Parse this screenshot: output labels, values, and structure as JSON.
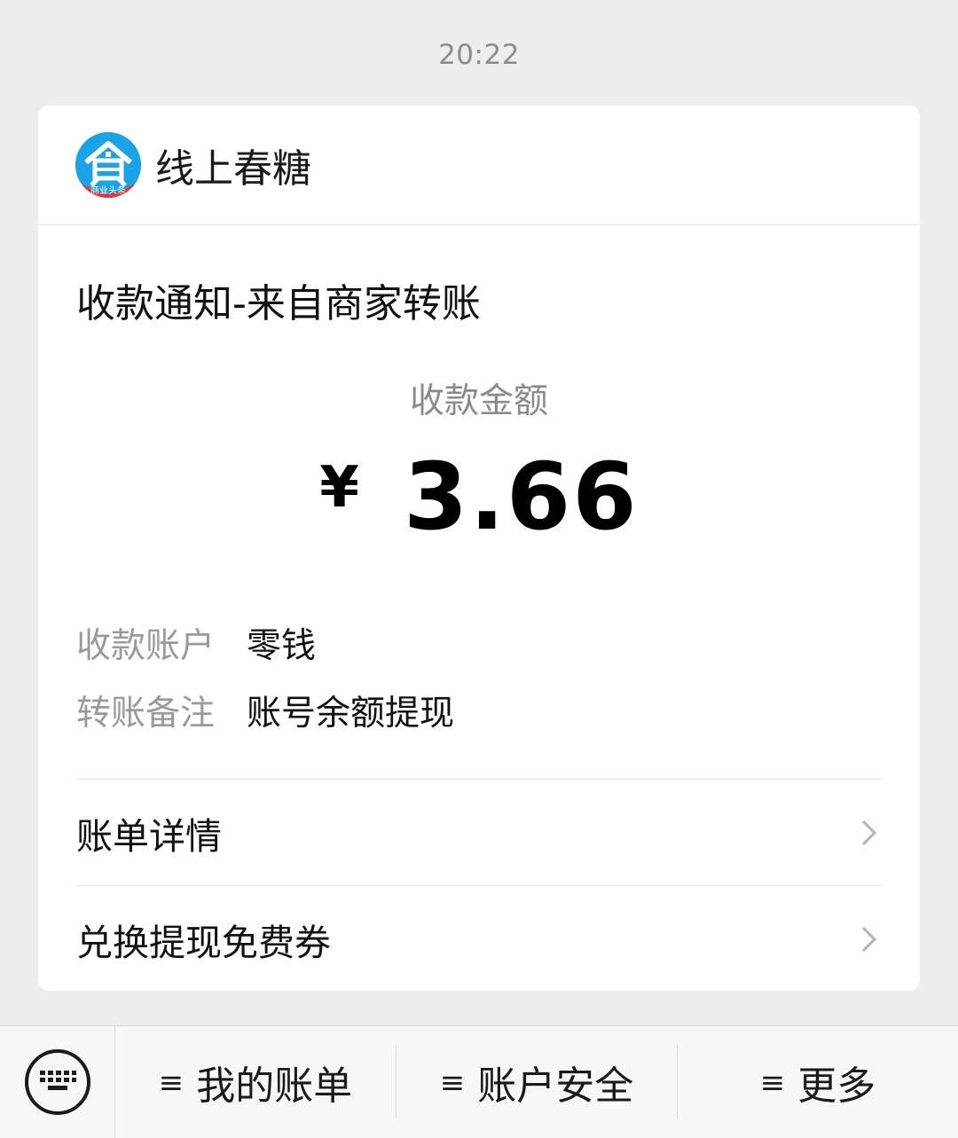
{
  "status": {
    "time": "20:22"
  },
  "message": {
    "sender": {
      "name": "线上春糖",
      "avatar_icon": "house-logo-icon",
      "avatar_badge_text": "商业头条"
    },
    "title": "收款通知-来自商家转账",
    "amount_label": "收款金额",
    "currency_symbol": "¥",
    "amount_value": "3.66",
    "details": [
      {
        "key": "收款账户",
        "value": "零钱"
      },
      {
        "key": "转账备注",
        "value": "账号余额提现"
      }
    ],
    "links": [
      {
        "label": "账单详情"
      },
      {
        "label": "兑换提现免费券"
      }
    ]
  },
  "bottom_bar": {
    "keyboard_icon": "keyboard-icon",
    "menu": [
      {
        "icon": "≡",
        "label": "我的账单"
      },
      {
        "icon": "≡",
        "label": "账户安全"
      },
      {
        "icon": "≡",
        "label": "更多"
      }
    ]
  },
  "colors": {
    "background": "#ededed",
    "card": "#ffffff",
    "avatar": "#1aa3e6"
  }
}
